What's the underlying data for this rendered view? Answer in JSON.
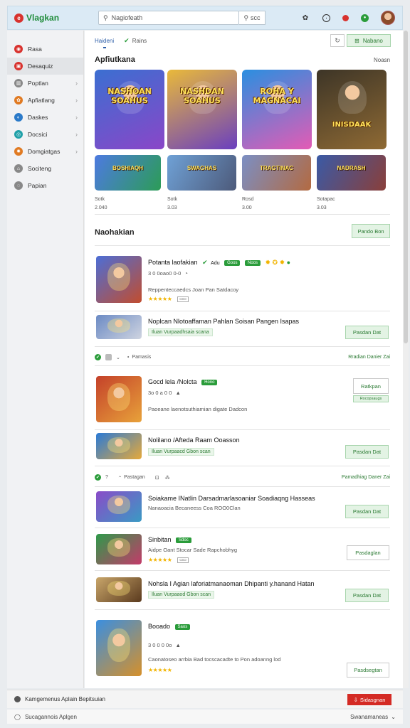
{
  "app": {
    "name": "Vlagkan"
  },
  "search": {
    "placeholder": "Nagiofeath",
    "button": "scc"
  },
  "sidebar": {
    "items": [
      {
        "label": "Rasa",
        "color": "#d8322e"
      },
      {
        "label": "Desaquiz",
        "color": "#d8322e",
        "active": true
      },
      {
        "label": "Poptlan",
        "color": "#888888"
      },
      {
        "label": "Apfiatlang",
        "color": "#e07a22"
      },
      {
        "label": "Daskes",
        "color": "#2b7ac9"
      },
      {
        "label": "Docsici",
        "color": "#1fa0a8"
      },
      {
        "label": "Domgiatgas",
        "color": "#e07a22"
      },
      {
        "label": "Sociteng",
        "color": "#888888"
      },
      {
        "label": "Papian",
        "color": "#888888"
      }
    ]
  },
  "header": {
    "tabs": [
      "Haideni",
      "Rains"
    ],
    "action_label": "Nabano"
  },
  "featured": {
    "title": "Apfiutkana",
    "link": "Noasn",
    "cards": [
      {
        "title": "NASHOAN SOAHUS",
        "bg": [
          "#3b6fd1",
          "#8a46c8"
        ]
      },
      {
        "title": "NASHDAN SOAHUS",
        "bg": [
          "#e9b93a",
          "#6a3fbf"
        ]
      },
      {
        "title": "ROHA Y MAGNACAI",
        "bg": [
          "#2a8fe0",
          "#e35bb5"
        ]
      },
      {
        "title": "INISDAAK",
        "bg": [
          "#3d3527",
          "#8f6a34"
        ]
      }
    ],
    "banners": [
      {
        "title": "BOSHIAQH",
        "bg": [
          "#4d7ae0",
          "#2c9c57"
        ]
      },
      {
        "title": "SWAGHAS",
        "bg": [
          "#6fa1d6",
          "#4d5a7a"
        ]
      },
      {
        "title": "TRAGTINAC",
        "bg": [
          "#7b8fc4",
          "#b36a41"
        ]
      },
      {
        "title": "NADRASH",
        "bg": [
          "#3a5aa6",
          "#8a3f3a"
        ]
      }
    ],
    "meta": [
      {
        "line1": "Sotk",
        "line2": "2.040"
      },
      {
        "line1": "Sotk",
        "line2": "3.03"
      },
      {
        "line1": "Rosd",
        "line2": "3.00"
      },
      {
        "line1": "Sotapac",
        "line2": "3.03"
      }
    ]
  },
  "listing": {
    "title": "Naohakian",
    "action": "Pando Bon",
    "rows": [
      {
        "title": "Potanta laofakian",
        "badges": [
          "Adu",
          "Goos",
          "Noos"
        ],
        "sub": "3 0 0oao0 0-0",
        "desc": "Reppenteccaedcs Joan  Pan  Satdacoy",
        "stars": "★★★★★",
        "thumb": [
          "#4c6ed6",
          "#c24d2e"
        ]
      },
      {
        "title": "Noplcan  Nlotoaffaman  Pahlan  Soisan  Pangen  Isapas",
        "chip": "Iluan  Vurpaadhsaia scana",
        "button": "Pasdan Dat",
        "thumb": [
          "#6b8ac4",
          "#cfd4e0"
        ]
      },
      {
        "title": "Gocd lela  /Nolcta",
        "badge": "Hono",
        "sub": "3o 0 a 0 0",
        "desc": "Paoeane laenotsuthiamian digate Dadcon",
        "button": "Ratkpan",
        "button2": "Rocopsaugs",
        "thumb": [
          "#c4412a",
          "#e8a23a"
        ]
      },
      {
        "title": "Nolilano  /Afteda  Raam  Ooasson",
        "chip": "Iluan  Vurpaacd Gbon scan",
        "button": "Pasdan Dat",
        "thumb": [
          "#2a7ad6",
          "#e6a93a"
        ]
      },
      {
        "title": "Soiakame  INatlin  Darsadmarlasoaniar  Soadiaqng  Hasseas",
        "desc": "Nanaoacia Becaneess Coa ROO0Clan",
        "button": "Pasdan Dat",
        "thumb": [
          "#8a4bc8",
          "#3a9ac4"
        ]
      },
      {
        "title": "Sinbitan",
        "badge": "Sdoc",
        "desc": "Aidpe Oant Stocar  Sade  Rapchobhyg",
        "stars": "★★★★★",
        "button": "Pasdaglan",
        "thumb": [
          "#2e9a4a",
          "#c43a6a"
        ]
      },
      {
        "title": "Nohsla  I Agian  laforiatmanaoman  Dhipanti  y.hanand  Hatan",
        "chip": "Iluan  Vurpaaod Gbon scan",
        "button": "Pasdan Dat",
        "thumb": [
          "#c9a66a",
          "#5a3a1e"
        ]
      },
      {
        "title": "Booado",
        "badge": "Saos",
        "sub": "3 0 0 0 0o",
        "desc": "Caonatoseo arrbia  Bad  tocscacadte  to  Pon adoanng lod",
        "stars": "★★★★★",
        "button": "Pasdsegtan",
        "thumb": [
          "#3a8fe0",
          "#d6902a"
        ]
      }
    ],
    "filters": [
      {
        "left": "Pamasis",
        "right": "Rradian Danier Zai"
      },
      {
        "left": "Pastagan",
        "right": "Pamadhiag Daner Zai"
      }
    ]
  },
  "footer": {
    "text": "Kamgemenus  Aplain  Bepitsuian",
    "button": "Sidasgnan",
    "bottom_left": "Sucagannois  Aplgen",
    "bottom_right": "Swanamaneas"
  }
}
